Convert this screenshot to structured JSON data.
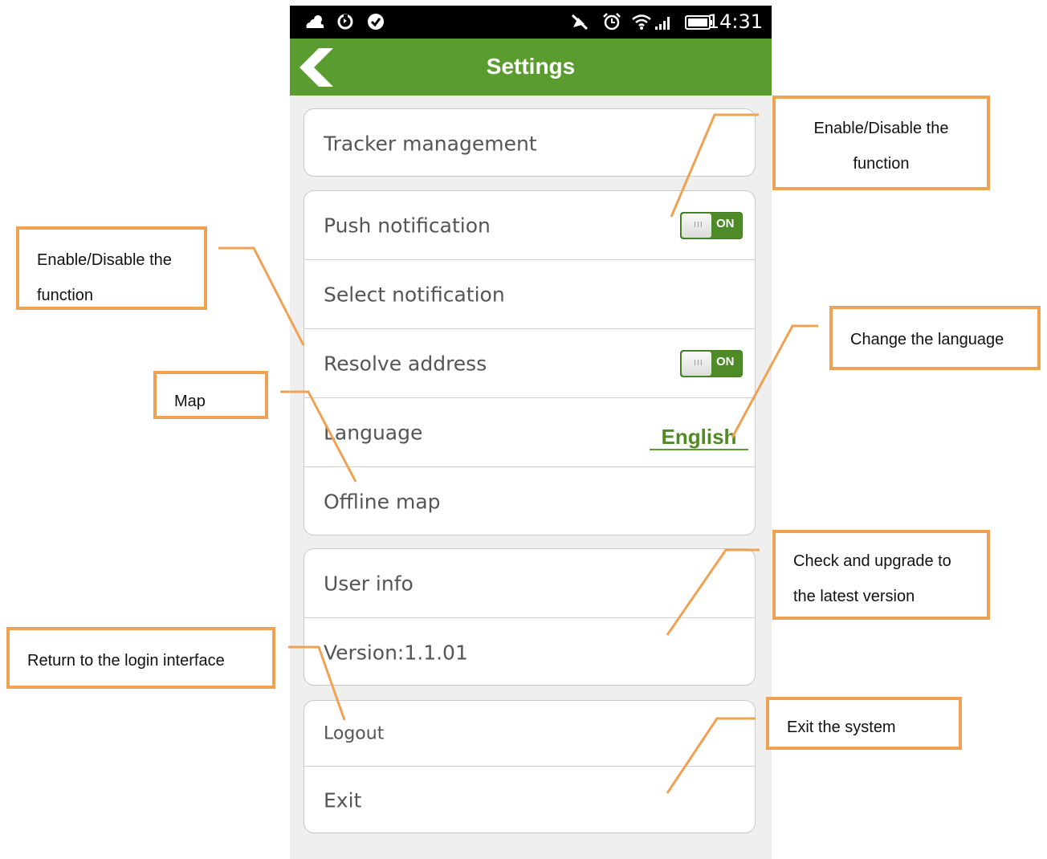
{
  "status_bar": {
    "time": "14:31"
  },
  "header": {
    "title": "Settings"
  },
  "settings": {
    "tracker_management": "Tracker management",
    "push_notification": "Push notification",
    "select_notification": "Select notification",
    "resolve_address": "Resolve address",
    "language": "Language",
    "language_value": "English",
    "offline_map": "Offline map",
    "user_info": "User info",
    "version": "Version:1.1.01",
    "logout": "Logout",
    "exit": "Exit",
    "toggle_on_text": "ON",
    "toggle_knob_grip": "III",
    "push_notification_enabled": true,
    "resolve_address_enabled": true
  },
  "annotations": {
    "push_toggle_line1": "Enable/Disable the",
    "push_toggle_line2": "function",
    "resolve_line1": "Enable/Disable the",
    "resolve_line2": "function",
    "language": "Change the language",
    "map": "Map",
    "version_line1": "Check and upgrade to",
    "version_line2": "the latest version",
    "logout": "Return to the login interface",
    "exit": "Exit the system"
  },
  "colors": {
    "header_green": "#5b9c30",
    "toggle_green": "#4e8a27",
    "annotation_orange": "#f0a254"
  },
  "icons": [
    "cloud-icon",
    "sync-icon",
    "check-circle-icon",
    "silent-icon",
    "alarm-icon",
    "wifi-icon",
    "signal-icon",
    "battery-icon",
    "back-arrow-icon"
  ]
}
